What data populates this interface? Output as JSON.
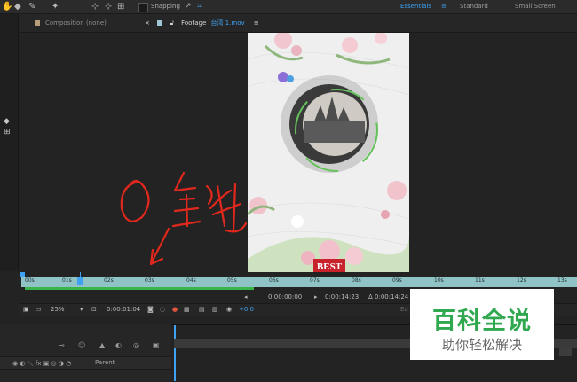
{
  "toolbar": {
    "snapping_label": "Snapping",
    "workspaces": [
      "Essentials",
      "Standard",
      "Small Screen"
    ],
    "active_workspace": "Essentials",
    "menu_glyph": "≡",
    "icons": [
      "hand-tool-icon",
      "eraser-icon",
      "puppet-pin-icon",
      "pin-icon",
      "axis-icon",
      "snap-icon"
    ]
  },
  "tabs": {
    "composition": "Composition (none)",
    "footage_prefix": "Footage",
    "footage_file": "台湾 1.mov",
    "close_glyph": "×",
    "menu_glyph": "≡"
  },
  "annotation": {
    "text": "O 链",
    "color": "#e0281c"
  },
  "ruler": {
    "ticks": [
      "00s",
      "01s",
      "02s",
      "03s",
      "04s",
      "05s",
      "06s",
      "07s",
      "08s",
      "09s",
      "10s",
      "11s",
      "12s",
      "13s"
    ]
  },
  "viewer_footer": {
    "zoom": "25%",
    "current_time": "0:00:01:04",
    "exposure": "+0.0",
    "in_point": "0:00:00:00",
    "out_point": "0:00:14:23",
    "duration": "Δ 0:00:14:24",
    "edit_label": "Ed"
  },
  "timeline": {
    "parent_label": "Parent"
  },
  "footage": {
    "banner_text": "BEST"
  },
  "watermark": {
    "title": "百科全说",
    "subtitle": "助你轻松解决",
    "color": "#2fa84f"
  }
}
